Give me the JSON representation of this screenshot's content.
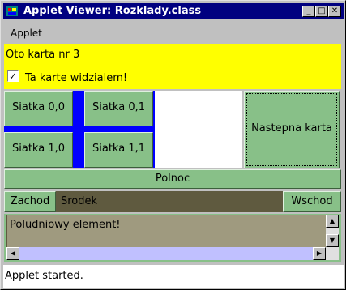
{
  "window": {
    "title": "Applet Viewer: Rozklady.class",
    "controls": {
      "minimize": "_",
      "maximize": "□",
      "close": "✕"
    }
  },
  "menu": {
    "items": [
      "Applet"
    ]
  },
  "card_panel": {
    "label": "Oto karta nr 3",
    "checkbox": {
      "label": "Ta karte widzialem!",
      "checked": true
    }
  },
  "grid_buttons": [
    "Siatka 0,0",
    "Siatka 0,1",
    "Siatka 1,0",
    "Siatka 1,1"
  ],
  "next_card_button": "Nastepna karta",
  "border_layout": {
    "north": "Polnoc",
    "west": "Zachod",
    "center": "Srodek",
    "east": "Wschod"
  },
  "text_area": {
    "value": "Poludniowy element!"
  },
  "status": {
    "text": "Applet started."
  },
  "colors": {
    "title_bar": "#000080",
    "yellow_panel": "#ffff00",
    "button_green": "#88c088",
    "grid_gap": "#0000ff",
    "center_band": "#5f5a3f",
    "text_area_bg": "#9f9a7f",
    "h_scroll": "#c0c0ff"
  }
}
